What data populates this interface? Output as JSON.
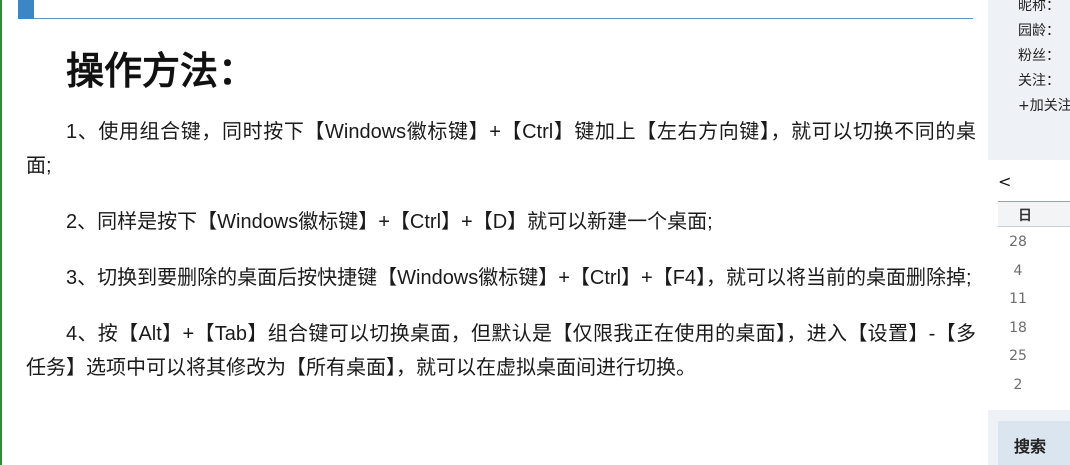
{
  "article": {
    "heading": "操作方法：",
    "paragraphs": [
      "1、使用组合键，同时按下【Windows徽标键】+【Ctrl】键加上【左右方向键】，就可以切换不同的桌面;",
      "2、同样是按下【Windows徽标键】+【Ctrl】+【D】就可以新建一个桌面;",
      "3、切换到要删除的桌面后按快捷键【Windows徽标键】+【Ctrl】+【F4】，就可以将当前的桌面删除掉;",
      "4、按【Alt】+【Tab】组合键可以切换桌面，但默认是【仅限我正在使用的桌面】，进入【设置】-【多任务】选项中可以将其修改为【所有桌面】，就可以在虚拟桌面间进行切换。"
    ]
  },
  "sidebar": {
    "profile": {
      "nickname_label": "昵称：",
      "age_label": "园龄：",
      "fans_label": "粉丝：",
      "follow_label": "关注：",
      "add_follow": "+加关注"
    },
    "calendar": {
      "prev": "<",
      "weekday_header": "日",
      "days": [
        "28",
        "4",
        "11",
        "18",
        "25",
        "2"
      ]
    },
    "search_title": "搜索"
  },
  "colors": {
    "accent_blue": "#3d86c6",
    "left_edge_green": "#2e8b3a",
    "sidebar_bg": "#eef1f5",
    "search_bg": "#dbe5ef"
  }
}
